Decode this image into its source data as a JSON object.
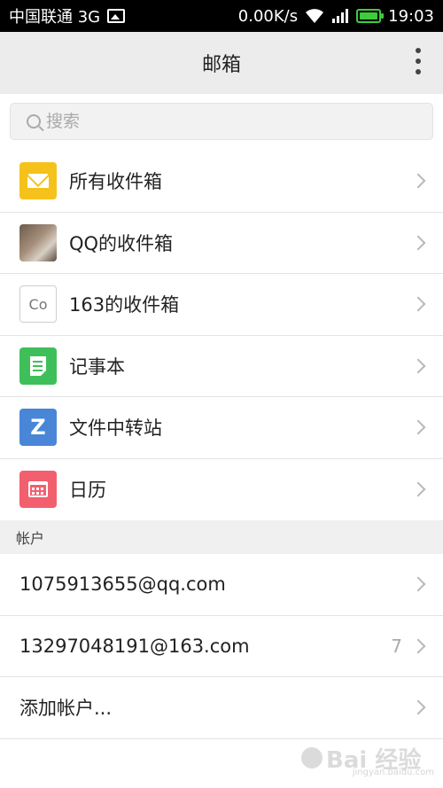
{
  "status_bar": {
    "carrier": "中国联通 3G",
    "network_speed": "0.00K/s",
    "time": "19:03"
  },
  "header": {
    "title": "邮箱"
  },
  "search": {
    "placeholder": "搜索"
  },
  "menu": {
    "items": [
      {
        "label": "所有收件箱",
        "icon": "mail-icon"
      },
      {
        "label": "QQ的收件箱",
        "icon": "qq-avatar-icon"
      },
      {
        "label": "163的收件箱",
        "icon": "co-icon",
        "icon_text": "Co"
      },
      {
        "label": "记事本",
        "icon": "notepad-icon"
      },
      {
        "label": "文件中转站",
        "icon": "transfer-icon",
        "icon_text": "Z"
      },
      {
        "label": "日历",
        "icon": "calendar-icon"
      }
    ]
  },
  "accounts": {
    "header": "帐户",
    "items": [
      {
        "label": "1075913655@qq.com",
        "count": ""
      },
      {
        "label": "13297048191@163.com",
        "count": "7"
      },
      {
        "label": "添加帐户...",
        "count": ""
      }
    ]
  },
  "watermark": {
    "brand": "Bai 经验",
    "url": "jingyan.baidu.com"
  },
  "colors": {
    "mail": "#f5c21c",
    "notepad": "#3fbf5a",
    "transfer": "#4a86d8",
    "calendar": "#f25f6e",
    "battery": "#3ecb3e"
  }
}
